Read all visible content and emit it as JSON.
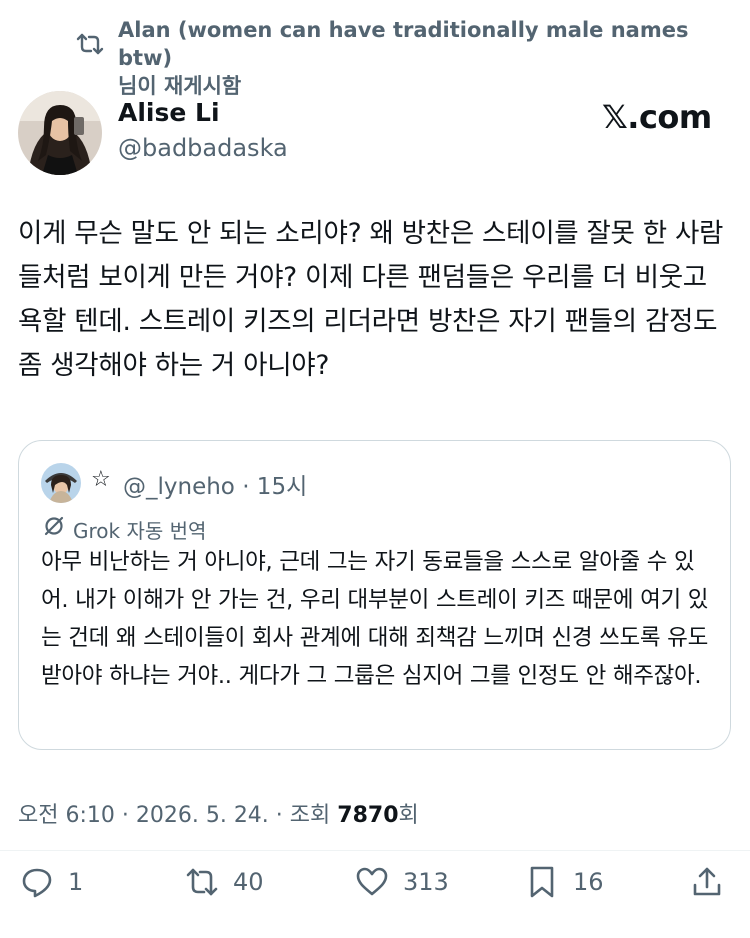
{
  "retweet": {
    "label_line1": "Alan (women can have traditionally male names btw)",
    "label_line2": "님이 재게시함"
  },
  "author": {
    "name": "Alise Li",
    "handle": "@badbadaska"
  },
  "brand": "𝕏.com",
  "tweet": {
    "text": "이게 무슨 말도 안 되는 소리야? 왜 방찬은 스테이를 잘못 한 사람들처럼 보이게 만든 거야? 이제 다른 팬덤들은 우리를 더 비웃고 욕할 텐데. 스트레이 키즈의 리더라면 방찬은 자기 팬들의 감정도 좀 생각해야 하는 거 아니야?"
  },
  "quote": {
    "star": "☆",
    "handle_time": "@_lyneho · 15시",
    "translation_label": "Grok 자동 번역",
    "text": "아무 비난하는 거 아니야, 근데 그는 자기 동료들을 스스로 알아줄 수 있어. 내가 이해가 안 가는 건, 우리 대부분이 스트레이 키즈 때문에 여기 있는 건데 왜 스테이들이 회사 관계에 대해 죄책감 느끼며 신경 쓰도록 유도받아야 하냐는 거야.. 게다가 그 그룹은 심지어 그를 인정도 안 해주잖아."
  },
  "meta": {
    "time": "오전 6:10 · 2026. 5. 24. · 조회 ",
    "views": "7870",
    "views_suffix": "회"
  },
  "actions": {
    "replies": "1",
    "reposts": "40",
    "likes": "313",
    "bookmarks": "16"
  },
  "icons": [
    "repost-icon",
    "grok-icon",
    "reply-icon",
    "like-icon",
    "bookmark-icon",
    "share-icon"
  ]
}
